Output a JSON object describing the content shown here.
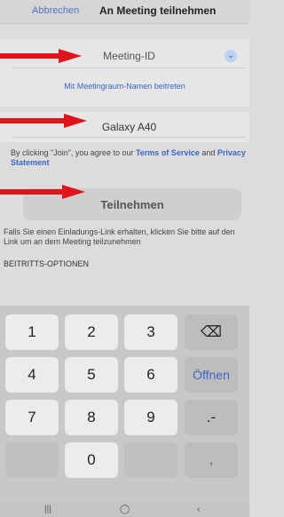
{
  "header": {
    "cancel_label": "Abbrechen",
    "title": "An Meeting teilnehmen"
  },
  "form": {
    "meeting_id_placeholder": "Meeting-ID",
    "join_by_name_link": "Mit Meetingraum-Namen beitreten",
    "name_value": "Galaxy A40",
    "terms_prefix": "By clicking \"Join\", you agree to our ",
    "terms_link": "Terms of Service",
    "terms_and": " and ",
    "privacy_link": "Privacy Statement",
    "join_button": "Teilnehmen",
    "hint": "Falls Sie einen Einladungs-Link erhalten, klicken Sie bitte auf den Link um an dem Meeting teilzunehmen",
    "options_heading": "BEITRITTS-OPTIONEN"
  },
  "keypad": {
    "rows": [
      [
        "1",
        "2",
        "3",
        "⌫"
      ],
      [
        "4",
        "5",
        "6",
        "Öffnen"
      ],
      [
        "7",
        "8",
        "9",
        ".-"
      ],
      [
        "",
        "0",
        "",
        ","
      ]
    ]
  },
  "icons": {
    "chevron": "chevron-down-icon",
    "backspace": "backspace-icon",
    "arrow": "red-arrow-annotation-icon"
  },
  "colors": {
    "accent": "#3a66c8",
    "arrow": "#e0141b"
  }
}
